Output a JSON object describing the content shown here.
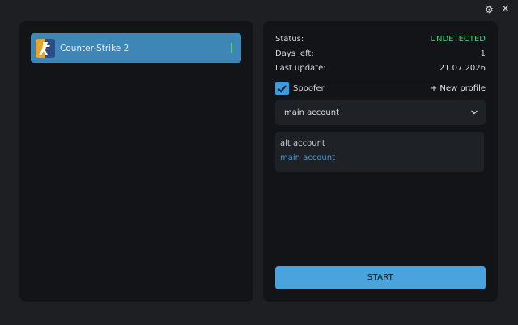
{
  "window": {
    "settings_icon": "gear-icon",
    "close_icon": "close-icon"
  },
  "games": [
    {
      "label": "Counter-Strike 2",
      "icon": "counter-strike-icon",
      "status_color": "#58d27c"
    }
  ],
  "info": {
    "status_label": "Status:",
    "status_value": "UNDETECTED",
    "status_color": "#4ec97a",
    "days_label": "Days left:",
    "days_value": "1",
    "update_label": "Last update:",
    "update_value": "21.07.2026"
  },
  "spoofer": {
    "label": "Spoofer",
    "checked": true
  },
  "new_profile_label": "+ New profile",
  "profile_select": {
    "selected": "main account",
    "options": [
      "alt account",
      "main account"
    ]
  },
  "start_label": "START",
  "colors": {
    "accent": "#49a3dc",
    "selected_item": "#3e86b5"
  }
}
